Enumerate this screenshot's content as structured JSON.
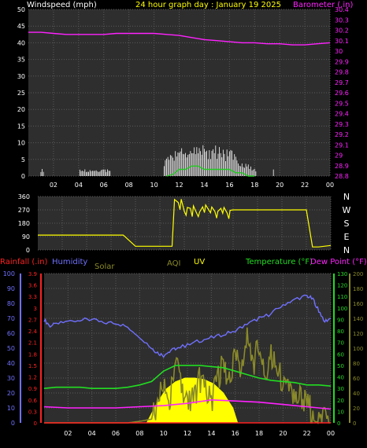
{
  "title": "24 hour graph day : January 19 2025",
  "colors": {
    "background": "#000000",
    "plot_background": "#2e2e2e",
    "grid": "#5a5a5a",
    "axis_text": "#ffffff",
    "windspeed": "#ffffff",
    "gust": "#ffffff",
    "avg_wind": "#22cc22",
    "barometer": "#ff22ff",
    "direction": "#ffff00",
    "rainfall": "#ff2222",
    "humidity": "#7070ff",
    "solar": "#8a8a2a",
    "aqi": "#8a8a2a",
    "uv": "#ffff00",
    "temperature": "#22dd22",
    "dewpoint": "#ff22ff",
    "temp_axis": "#22dd22",
    "title": "#ffff00"
  },
  "chart_data": [
    {
      "id": "wind-barometer",
      "type": "line",
      "labels": {
        "left": "Windspeed (mph)",
        "right": "Barometer (.in)"
      },
      "x_ticks": [
        "02",
        "04",
        "06",
        "08",
        "10",
        "12",
        "14",
        "16",
        "18",
        "20",
        "22",
        "00"
      ],
      "y_left": {
        "min": 0,
        "max": 50,
        "ticks": [
          "0",
          "5",
          "10",
          "15",
          "20",
          "25",
          "30",
          "35",
          "40",
          "45",
          "50"
        ]
      },
      "y_right": {
        "min": 28.8,
        "max": 30.4,
        "ticks": [
          "28.8",
          "28.9",
          "29",
          "29.1",
          "29.2",
          "29.3",
          "29.4",
          "29.5",
          "29.6",
          "29.7",
          "29.8",
          "29.9",
          "30",
          "30.1",
          "30.2",
          "30.3",
          "30.4"
        ]
      },
      "series": [
        {
          "key": "barometer",
          "axis": "right",
          "x": [
            0,
            1,
            2,
            3,
            4,
            5,
            6,
            7,
            8,
            9,
            10,
            11,
            12,
            13,
            14,
            15,
            16,
            17,
            18,
            19,
            20,
            21,
            22,
            23,
            24
          ],
          "y": [
            30.18,
            30.18,
            30.17,
            30.16,
            30.16,
            30.16,
            30.16,
            30.17,
            30.17,
            30.17,
            30.17,
            30.16,
            30.15,
            30.13,
            30.11,
            30.1,
            30.09,
            30.08,
            30.08,
            30.07,
            30.07,
            30.06,
            30.06,
            30.07,
            30.08
          ]
        },
        {
          "key": "gust",
          "axis": "left",
          "x": [
            1,
            4.1,
            4.5,
            5.9,
            6.2,
            11,
            11.3,
            11.6,
            12,
            12.4,
            12.8,
            13.2,
            13.6,
            14,
            14.4,
            14.8,
            15.2,
            15.6,
            16,
            16.4,
            16.8,
            17.2,
            17.6,
            18,
            19.6
          ],
          "y": [
            2,
            2,
            2,
            2,
            2,
            5,
            6,
            7,
            8,
            9,
            8,
            9,
            8,
            9,
            8,
            9,
            8,
            7,
            8,
            6,
            5,
            4,
            3,
            2,
            2
          ]
        },
        {
          "key": "avg_wind",
          "axis": "left",
          "x": [
            11,
            11.5,
            12,
            12.5,
            13,
            13.5,
            14,
            14.5,
            15,
            15.5,
            16,
            16.5,
            17,
            17.5,
            18
          ],
          "y": [
            0,
            0.5,
            2,
            2,
            3,
            3,
            2,
            2,
            2,
            2,
            2,
            1,
            1,
            0,
            0
          ]
        }
      ]
    },
    {
      "id": "wind-direction",
      "type": "line",
      "y_ticks": [
        "0",
        "90",
        "180",
        "270",
        "360"
      ],
      "compass": [
        "N",
        "W",
        "S",
        "E",
        "N"
      ],
      "series": [
        {
          "key": "direction",
          "x": [
            0,
            1,
            2,
            3,
            4,
            5,
            6,
            7,
            8,
            9,
            10,
            10.5,
            11,
            11.2,
            11.5,
            12,
            12.5,
            13,
            13.5,
            14,
            14.5,
            15,
            15.5,
            16,
            16.5,
            17,
            18,
            19,
            20,
            21,
            22,
            22.5,
            23,
            24
          ],
          "y": [
            100,
            100,
            100,
            100,
            100,
            100,
            100,
            100,
            25,
            25,
            25,
            25,
            25,
            340,
            320,
            260,
            280,
            250,
            290,
            270,
            260,
            280,
            250,
            270,
            270,
            270,
            270,
            270,
            270,
            270,
            270,
            20,
            20,
            30
          ]
        }
      ]
    },
    {
      "id": "rain-humidity-temp",
      "type": "line",
      "labels": {
        "rainfall": "Rainfall (.in)",
        "humidity": "Humidity",
        "solar": "Solar",
        "aqi": "AQI",
        "uv": "UV",
        "temperature": "Temperature (°F)",
        "dewpoint": "Dew Point (°F)"
      },
      "x_ticks": [
        "02",
        "04",
        "06",
        "08",
        "10",
        "12",
        "14",
        "16",
        "18",
        "20",
        "22",
        "00"
      ],
      "y_humidity": {
        "min": 0,
        "max": 100,
        "ticks": [
          "0",
          "10",
          "20",
          "30",
          "40",
          "50",
          "60",
          "70",
          "80",
          "90",
          "100"
        ]
      },
      "y_rain": {
        "min": 0,
        "max": 3.9,
        "ticks": [
          "0",
          "0.3",
          "0.6",
          "0.9",
          "1.2",
          "1.5",
          "1.8",
          "2.1",
          "2.4",
          "2.7",
          "3",
          "3.3",
          "3.6",
          "3.9"
        ]
      },
      "y_temp": {
        "min": 0,
        "max": 130,
        "ticks": [
          "0",
          "10",
          "20",
          "30",
          "40",
          "50",
          "60",
          "70",
          "80",
          "90",
          "100",
          "110",
          "120",
          "130"
        ]
      },
      "y_uv_solar": {
        "min": 0,
        "max": 200,
        "ticks": [
          "0",
          "20",
          "40",
          "60",
          "80",
          "100",
          "120",
          "140",
          "160",
          "180",
          "200"
        ]
      },
      "series": [
        {
          "key": "humidity",
          "x": [
            0,
            0.5,
            1,
            2,
            3,
            4,
            5,
            6,
            7,
            8,
            9,
            9.5,
            10,
            10.5,
            11,
            12,
            13,
            14,
            15,
            16,
            17,
            18,
            19,
            20,
            21,
            22,
            22.5,
            23,
            23.5,
            24
          ],
          "y": [
            69,
            65,
            66,
            68,
            69,
            69,
            67,
            67,
            64,
            58,
            50,
            47,
            45,
            48,
            50,
            52,
            55,
            57,
            59,
            62,
            66,
            70,
            73,
            79,
            83,
            85,
            83,
            75,
            68,
            70
          ]
        },
        {
          "key": "temperature",
          "x": [
            0,
            1,
            2,
            3,
            4,
            5,
            6,
            7,
            8,
            9,
            10,
            11,
            12,
            13,
            14,
            15,
            16,
            17,
            18,
            19,
            20,
            21,
            22,
            23,
            24
          ],
          "y": [
            30,
            31,
            31,
            31,
            30,
            30,
            30,
            31,
            33,
            36,
            45,
            50,
            50,
            50,
            49,
            48,
            45,
            42,
            39,
            37,
            36,
            35,
            33,
            33,
            32
          ]
        },
        {
          "key": "dewpoint",
          "x": [
            0,
            2,
            4,
            6,
            8,
            10,
            12,
            14,
            16,
            18,
            20,
            22,
            24
          ],
          "y": [
            14,
            13,
            13,
            13,
            14,
            15,
            17,
            20,
            19,
            18,
            16,
            14,
            12
          ]
        },
        {
          "key": "uv",
          "x": [
            8.6,
            9.4,
            10.2,
            11,
            11.8,
            12.6,
            13.4,
            14.2,
            15,
            15.8,
            16.2
          ],
          "y": [
            0,
            25,
            45,
            55,
            60,
            60,
            58,
            52,
            40,
            20,
            0
          ]
        },
        {
          "key": "solar",
          "x": [
            0,
            7,
            8,
            9,
            9.5,
            10,
            10.5,
            11,
            11.5,
            12,
            12.5,
            13,
            13.5,
            14,
            14.5,
            15,
            15.5,
            16,
            16.5,
            17,
            17.5,
            18,
            18.5,
            19,
            19.5,
            20,
            20.5,
            21,
            21.5,
            22,
            22.5,
            23,
            23.5,
            24
          ],
          "y": [
            0,
            0,
            2,
            5,
            20,
            60,
            30,
            95,
            40,
            20,
            30,
            60,
            40,
            30,
            60,
            80,
            50,
            95,
            75,
            110,
            80,
            100,
            60,
            90,
            70,
            55,
            40,
            30,
            35,
            25,
            15,
            10,
            5,
            3
          ]
        },
        {
          "key": "rainfall",
          "x": [
            0,
            24
          ],
          "y": [
            0,
            0
          ]
        }
      ]
    }
  ]
}
